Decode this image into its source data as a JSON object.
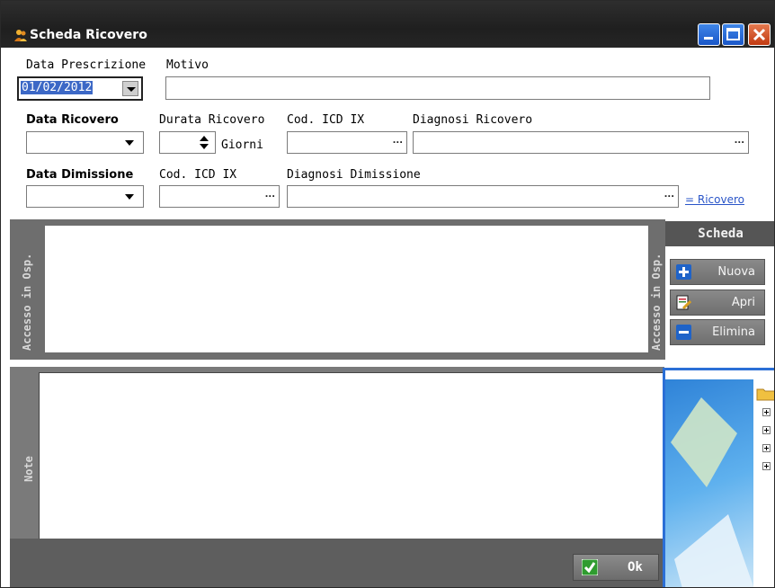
{
  "window": {
    "title": "Scheda Ricovero"
  },
  "form": {
    "data_prescrizione_label": "Data Prescrizione",
    "data_prescrizione_value": "01/02/2012",
    "motivo_label": "Motivo",
    "motivo_value": "",
    "data_ricovero_label": "Data Ricovero",
    "durata_ricovero_label": "Durata Ricovero",
    "durata_unit": "Giorni",
    "cod_icd_label": "Cod. ICD IX",
    "diagnosi_ricovero_label": "Diagnosi Ricovero",
    "data_dimissione_label": "Data Dimissione",
    "cod_icd_dimissione_label": "Cod. ICD IX",
    "diagnosi_dimissione_label": "Diagnosi Dimissione",
    "ellipsis": "...",
    "ricovero_link": "= Ricovero"
  },
  "panels": {
    "accesso_label": "Accesso in Osp.",
    "note_label": "Note"
  },
  "scheda": {
    "header": "Scheda",
    "buttons": [
      {
        "label": "Nuova",
        "icon": "plus-icon"
      },
      {
        "label": "Apri",
        "icon": "open-document-icon"
      },
      {
        "label": "Elimina",
        "icon": "minus-icon"
      }
    ]
  },
  "footer": {
    "ok_label": "Ok"
  },
  "colors": {
    "titlebar": "#262626",
    "panel_gray": "#6e6e6e",
    "selection_blue": "#3c68c6",
    "link_blue": "#2a55c8"
  }
}
